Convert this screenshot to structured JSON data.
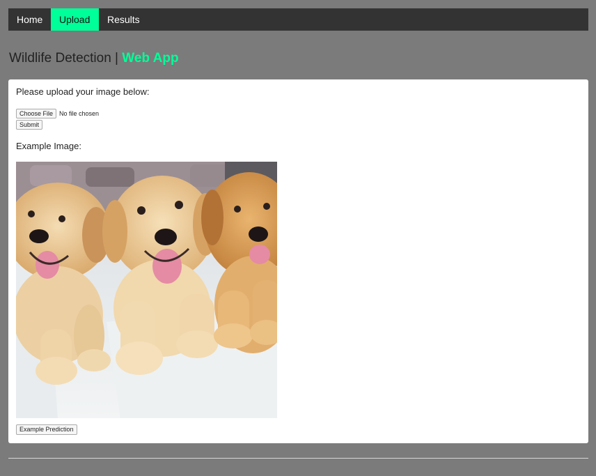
{
  "nav": {
    "items": [
      {
        "label": "Home"
      },
      {
        "label": "Upload"
      },
      {
        "label": "Results"
      }
    ],
    "active": "Upload",
    "accent_color": "#00ff99",
    "bar_color": "#333333"
  },
  "header": {
    "title": "Wildlife Detection | ",
    "title_accent": "Web App"
  },
  "upload": {
    "prompt": "Please upload your image below:",
    "choose_file_label": "Choose File",
    "no_file_text": "No file chosen",
    "submit_label": "Submit"
  },
  "example": {
    "label": "Example Image:",
    "image_subject": "three golden retriever puppies",
    "predict_label": "Example Prediction"
  }
}
